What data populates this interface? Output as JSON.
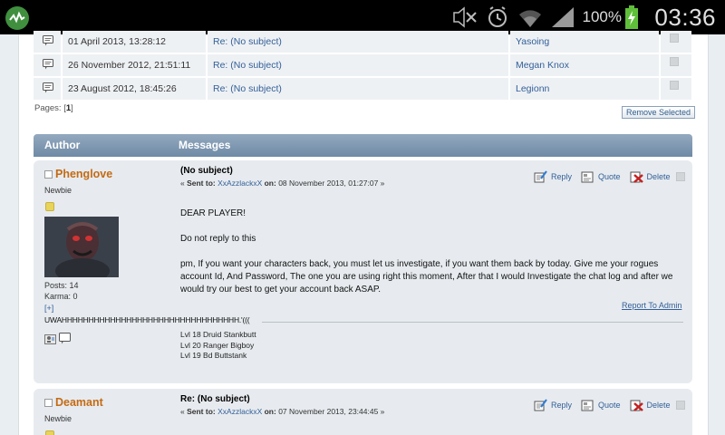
{
  "status_bar": {
    "battery_percent": "100%",
    "time": "03:36"
  },
  "pm_list": {
    "rows": [
      {
        "date": "01 April 2013, 13:28:12",
        "subject": "Re: (No subject)",
        "from": "Yasoing"
      },
      {
        "date": "26 November 2012, 21:51:11",
        "subject": "Re: (No subject)",
        "from": "Megan Knox"
      },
      {
        "date": "23 August 2012, 18:45:26",
        "subject": "Re: (No subject)",
        "from": "Legionn"
      }
    ],
    "pages_label": "Pages: [",
    "pages_current": "1",
    "pages_close": "]",
    "remove_selected_label": "Remove Selected"
  },
  "header": {
    "author_label": "Author",
    "messages_label": "Messages"
  },
  "posts": [
    {
      "poster": "Phenglove",
      "rank": "Newbie",
      "posts": "Posts: 14",
      "karma": "Karma: 0",
      "more": "[+]",
      "subject": "(No subject)",
      "sent_prefix": "« ",
      "sent_to_label": "Sent to:",
      "sent_to": "XxAzzlackxX",
      "on_label": "on:",
      "sent_date": "08 November 2013, 01:27:07 »",
      "reply_label": "Reply",
      "quote_label": "Quote",
      "delete_label": "Delete",
      "body": [
        "DEAR PLAYER!",
        "Do not reply to this",
        "pm, If you want your characters back, you must let us investigate, if you want them back by today. Give me your rogues account Id, And Password, The one you are using right this moment, After that I would Investigate the chat log and after we would try our best to get your account back ASAP."
      ],
      "report_label": "Report To Admin",
      "sig_line": "UWAHHHHHHHHHHHHHHHHHHHHHHHHHHHHHHHHH.'(((",
      "signature": [
        "Lvl 18 Druid Stankbutt",
        "Lvl 20 Ranger Bigboy",
        "Lvl 19 Bd Buttstank"
      ]
    },
    {
      "poster": "Deamant",
      "rank": "Newbie",
      "subject": "Re: (No subject)",
      "sent_prefix": "« ",
      "sent_to_label": "Sent to:",
      "sent_to": "XxAzzlackxX",
      "on_label": "on:",
      "sent_date": "07 November 2013, 23:44:45 »",
      "reply_label": "Reply",
      "quote_label": "Quote",
      "delete_label": "Delete"
    }
  ],
  "colors": {
    "link": "#335f98",
    "poster_name": "#c46a13",
    "header_bar": "#7f98b2",
    "post_bg": "#e7ebef"
  }
}
